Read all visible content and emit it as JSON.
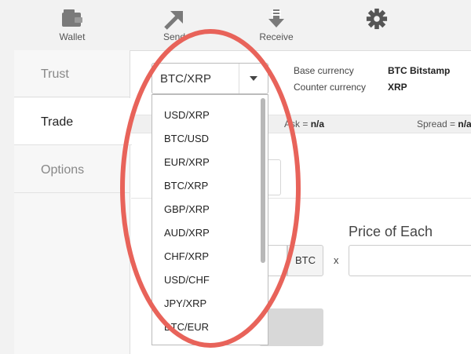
{
  "nav": {
    "wallet": "Wallet",
    "send": "Send",
    "receive": "Receive",
    "options_icon": "gear-icon"
  },
  "sidebar": {
    "items": [
      {
        "label": "Trust"
      },
      {
        "label": "Trade"
      },
      {
        "label": "Options"
      }
    ]
  },
  "pair_select": {
    "value": "BTC/XRP"
  },
  "dropdown": {
    "options": [
      "USD/XRP",
      "BTC/USD",
      "EUR/XRP",
      "BTC/XRP",
      "GBP/XRP",
      "AUD/XRP",
      "CHF/XRP",
      "USD/CHF",
      "JPY/XRP",
      "BTC/EUR"
    ]
  },
  "info": {
    "base_label": "Base currency",
    "base_value": "BTC Bitstamp",
    "counter_label": "Counter currency",
    "counter_value": "XRP"
  },
  "stats": {
    "ask_label": "Ask = ",
    "ask_value": "n/a",
    "spread_label": "Spread = ",
    "spread_value": "n/a"
  },
  "order": {
    "price_label": "Price of Each",
    "currency": "BTC",
    "times": "x"
  },
  "colors": {
    "annotation": "#e8635a"
  }
}
